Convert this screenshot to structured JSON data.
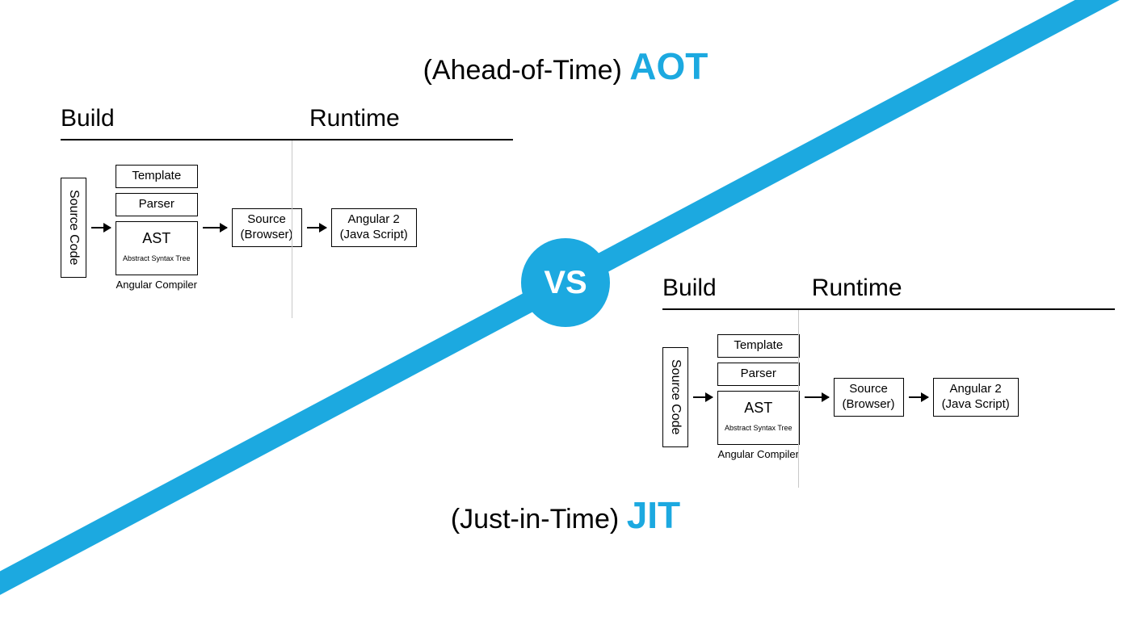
{
  "title_aot": {
    "full": "(Ahead-of-Time)",
    "abbr": "AOT"
  },
  "title_jit": {
    "full": "(Just-in-Time)",
    "abbr": "JIT"
  },
  "vs": "VS",
  "sections": {
    "build": "Build",
    "runtime": "Runtime"
  },
  "flow": {
    "source_code": "Source Code",
    "compiler_label": "Angular Compiler",
    "stack": {
      "template": "Template",
      "parser": "Parser",
      "ast_main": "AST",
      "ast_sub": "Abstract Syntax Tree"
    },
    "browser": "Source\n(Browser)",
    "output": "Angular 2\n(Java Script)"
  }
}
